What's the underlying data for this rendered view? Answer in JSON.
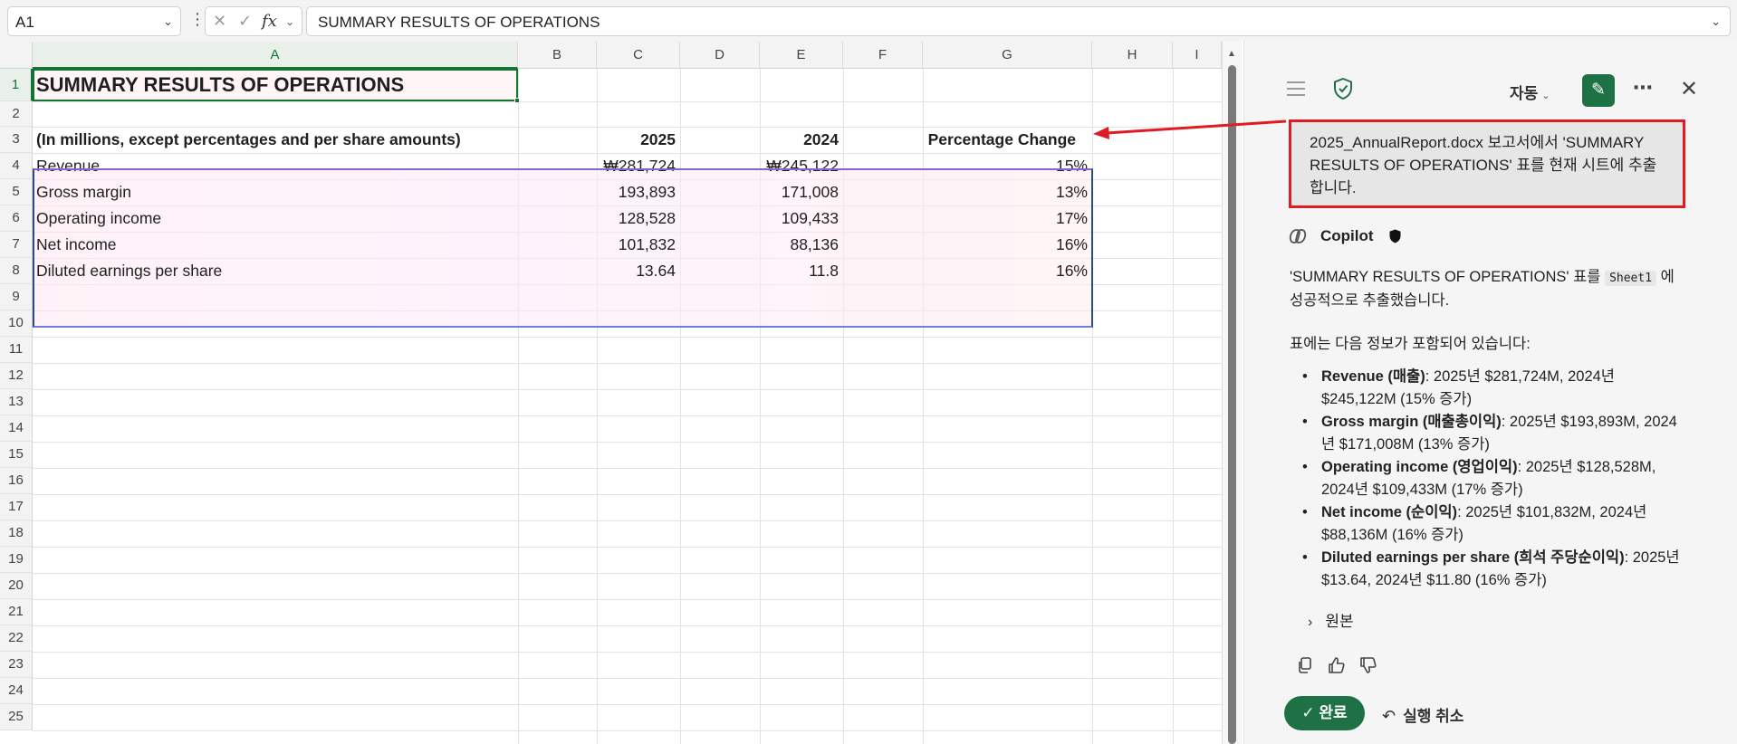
{
  "formula_bar": {
    "name_box": "A1",
    "cancel_glyph": "✕",
    "enter_glyph": "✓",
    "fx_label": "fx",
    "content": "SUMMARY RESULTS OF OPERATIONS"
  },
  "sheet": {
    "columns": [
      "A",
      "B",
      "C",
      "D",
      "E",
      "F",
      "G",
      "H",
      "I"
    ],
    "rows": [
      "1",
      "2",
      "3",
      "4",
      "5",
      "6",
      "7",
      "8",
      "9",
      "10",
      "11",
      "12",
      "13",
      "14",
      "15",
      "16",
      "17",
      "18",
      "19",
      "20",
      "21",
      "22",
      "23",
      "24",
      "25"
    ],
    "title": "SUMMARY RESULTS OF OPERATIONS",
    "table_header": {
      "label": "(In millions, except percentages and per share amounts)",
      "y2025": "2025",
      "y2024": "2024",
      "change": "Percentage Change"
    },
    "table_rows": [
      {
        "label": "Revenue",
        "y2025": "₩281,724",
        "y2024": "₩245,122",
        "change": "15%"
      },
      {
        "label": "Gross margin",
        "y2025": "193,893",
        "y2024": "171,008",
        "change": "13%"
      },
      {
        "label": "Operating income",
        "y2025": "128,528",
        "y2024": "109,433",
        "change": "17%"
      },
      {
        "label": "Net income",
        "y2025": "101,832",
        "y2024": "88,136",
        "change": "16%"
      },
      {
        "label": "Diluted earnings per share",
        "y2025": "13.64",
        "y2024": "11.8",
        "change": "16%"
      }
    ]
  },
  "copilot": {
    "mode_label": "자동",
    "prompt": "2025_AnnualReport.docx 보고서에서 'SUMMARY RESULTS OF OPERATIONS' 표를 현재 시트에 추출합니다.",
    "name": "Copilot",
    "response_pre": "'SUMMARY RESULTS OF OPERATIONS' 표를 ",
    "response_code": "Sheet1",
    "response_post": " 에 성공적으로 추출했습니다.",
    "intro": "표에는 다음 정보가 포함되어 있습니다:",
    "bullets": [
      {
        "key": "Revenue (매출)",
        "text": ": 2025년 $281,724M, 2024년 $245,122M (15% 증가)"
      },
      {
        "key": "Gross margin (매출총이익)",
        "text": ": 2025년 $193,893M, 2024년 $171,008M (13% 증가)"
      },
      {
        "key": "Operating income (영업이익)",
        "text": ": 2025년 $128,528M, 2024년 $109,433M (17% 증가)"
      },
      {
        "key": "Net income (순이익)",
        "text": ": 2025년 $101,832M, 2024년 $88,136M (16% 증가)"
      },
      {
        "key": "Diluted earnings per share (희석 주당순이익)",
        "text": ": 2025년 $13.64, 2024년 $11.80 (16% 증가)"
      }
    ],
    "source_label": "원본",
    "done_label": "완료",
    "undo_label": "실행 취소"
  },
  "colors": {
    "accent_green": "#1e7145",
    "annotation_red": "#e01b24",
    "selection_green": "#137333"
  },
  "icons": [
    "chevron-down-icon",
    "more-vertical-icon",
    "cancel-icon",
    "check-icon",
    "fx-icon",
    "hamburger-icon",
    "shield-check-icon",
    "new-chat-icon",
    "more-icon",
    "close-icon",
    "copilot-logo-icon",
    "shield-icon",
    "chevron-right-icon",
    "copy-icon",
    "thumbs-up-icon",
    "thumbs-down-icon",
    "undo-icon"
  ]
}
